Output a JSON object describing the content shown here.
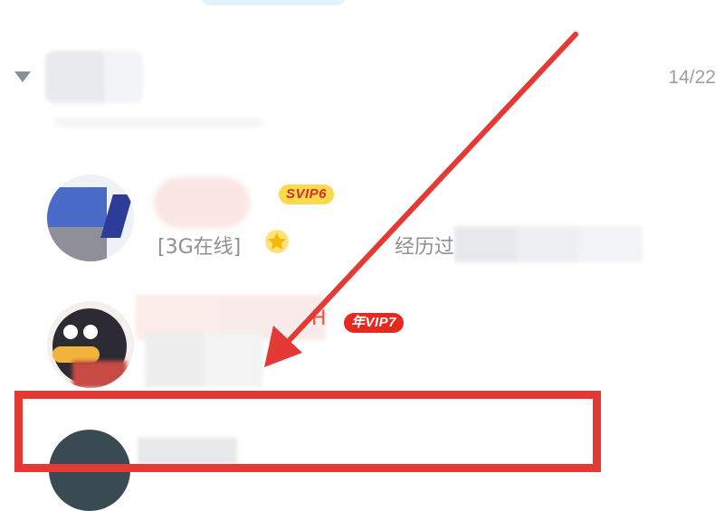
{
  "group": {
    "count": "14/22"
  },
  "contacts": [
    {
      "badge": "SVIP6",
      "status": "[3G在线]",
      "signature_prefix": "经历过"
    },
    {
      "name_tail": "H",
      "badge": "年VIP7"
    }
  ],
  "colors": {
    "highlight": "#e53935",
    "svip_badge_bg": "#ffd94c",
    "vip_badge_bg": "#e5291f",
    "muted_text": "#8c9097"
  }
}
